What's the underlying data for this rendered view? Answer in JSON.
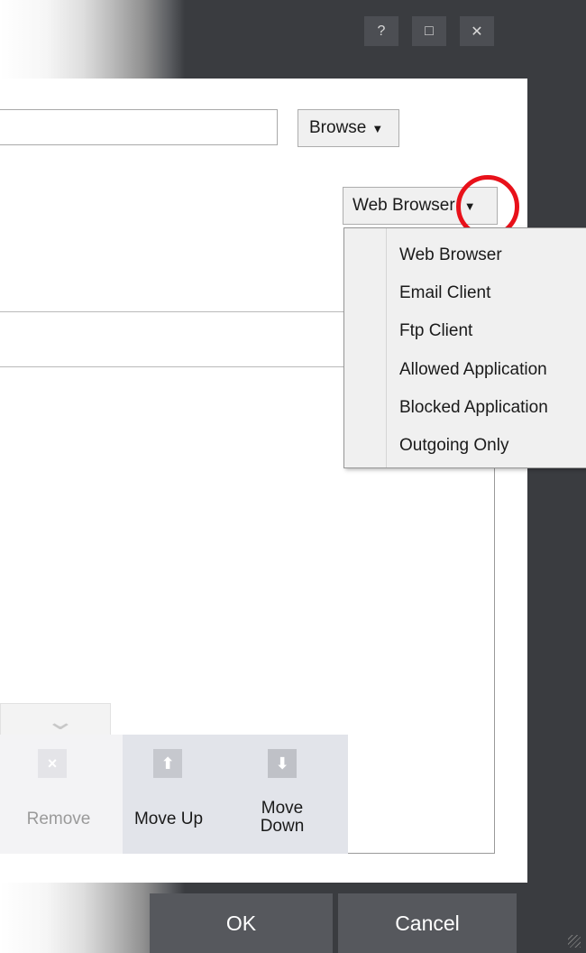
{
  "titlebar": {
    "help_glyph": "?",
    "maximize_glyph": "□",
    "close_glyph": "✕"
  },
  "browse_button": {
    "label": "Browse",
    "caret": "▼"
  },
  "type_dropdown": {
    "selected": "Web Browser",
    "caret": "▼"
  },
  "menu": {
    "items": [
      "Web Browser",
      "Email Client",
      "Ftp Client",
      "Allowed Application",
      "Blocked Application",
      "Outgoing Only"
    ]
  },
  "toolbar": {
    "remove_label": "Remove",
    "move_up_label": "Move Up",
    "move_down_label_1": "Move",
    "move_down_label_2": "Down",
    "remove_icon": "×",
    "up_icon": "⬆",
    "down_icon": "⬇"
  },
  "footer": {
    "ok_label": "OK",
    "cancel_label": "Cancel"
  },
  "colors": {
    "frame": "#3a3c40",
    "button": "#56585d",
    "highlight_circle": "#e8111a"
  }
}
